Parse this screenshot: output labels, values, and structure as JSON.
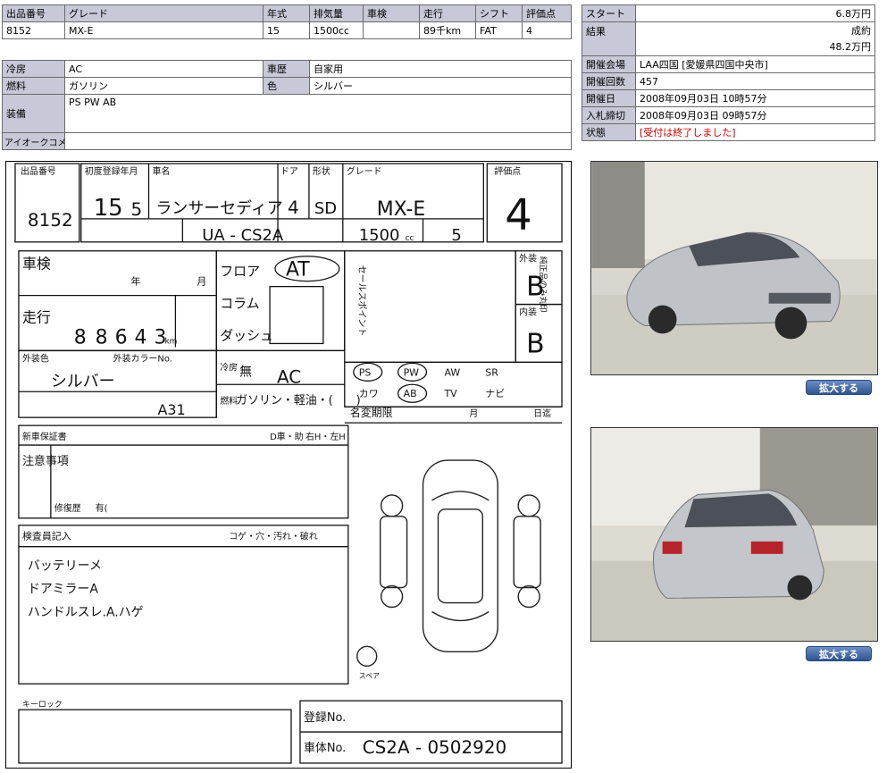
{
  "specs": {
    "headers": [
      "出品番号",
      "グレード",
      "年式",
      "排気量",
      "車検",
      "走行",
      "シフト",
      "評価点"
    ],
    "values": [
      "8152",
      "MX-E",
      "15",
      "1500cc",
      "",
      "89千km",
      "FAT",
      "4"
    ]
  },
  "details": {
    "aircon_label": "冷房",
    "aircon": "AC",
    "history_label": "車歴",
    "history": "自家用",
    "fuel_label": "燃料",
    "fuel": "ガソリン",
    "color_label": "色",
    "color": "シルバー",
    "equipment_label": "装備",
    "equipment": "PS PW AB",
    "comment_label": "アイオークコメント",
    "comment": ""
  },
  "auction": {
    "start_label": "スタート",
    "start": "6.8万円",
    "result_label": "結果",
    "result_status": "成約",
    "result_price": "48.2万円",
    "venue_label": "開催会場",
    "venue": "LAA四国 [愛媛県四国中央市]",
    "round_label": "開催回数",
    "round": "457",
    "date_label": "開催日",
    "date": "2008年09月03日 10時57分",
    "deadline_label": "入札締切",
    "deadline": "2008年09月03日 09時57分",
    "status_label": "状態",
    "status": "[受付は終了しました]",
    "status_color": "#d40000"
  },
  "sheet": {
    "lot_label": "出品番号",
    "lot": "8152",
    "first_reg_label": "初度登録年月",
    "year": "15",
    "month": "5",
    "name_label": "車名",
    "name": "ランサーセディア",
    "doors_label": "ドア",
    "doors": "4",
    "body_label": "形状",
    "body": "SD",
    "grade_label": "グレード",
    "grade": "MX-E",
    "score_label": "評価点",
    "score": "4",
    "model": "UA - CS2A",
    "cc": "1500",
    "cc_unit": "cc",
    "seats": "5",
    "shaken_label": "車検",
    "year_unit": "年",
    "month_unit": "月",
    "mileage_label": "走行",
    "mileage_digits": [
      "8",
      "8",
      "6",
      "4",
      "3"
    ],
    "km_unit": "km",
    "shift": "AT",
    "floor": "フロア",
    "column": "コラム",
    "dash": "ダッシュ",
    "sales_point_label": "セールスポイント",
    "exterior_label": "外装",
    "exterior": "B",
    "interior_label": "内装",
    "interior": "B",
    "color_label": "外装色",
    "color": "シルバー",
    "colorno_label": "外装カラーNo.",
    "colorno": "A31",
    "aircon_label": "冷房",
    "aircon_none": "無",
    "aircon": "AC",
    "fuel_label": "燃料",
    "fuel": "ガソリン・軽油・(　　)",
    "options": [
      "PS",
      "PW",
      "AW",
      "SR",
      "カワ",
      "AB",
      "TV",
      "ナビ"
    ],
    "genuine_label": "純正品のみ丸印",
    "name_change_label": "名変期限",
    "name_change_month": "月",
    "name_change_end": "日迄",
    "warranty_label": "新車保証書",
    "handle": "D車・助",
    "steer": "右H・左H",
    "notes_label": "注意事項",
    "repair_label": "修復歴",
    "repair_value": "有(",
    "inspector_label": "検査員記入",
    "inspector_notes": [
      "バッテリーメ",
      "ドアミラーA",
      "ハンドルスレ.A.ハゲ"
    ],
    "damage_legend": "コゲ・穴・汚れ・破れ",
    "spare_label": "スペア",
    "keylock_label": "キーロック",
    "reg_label": "登録No.",
    "chassis_label": "車体No.",
    "chassis": "CS2A - 0502920"
  },
  "photos": {
    "front_alt": "car-front-photo",
    "rear_alt": "car-rear-photo",
    "zoom_label": "拡大する"
  }
}
